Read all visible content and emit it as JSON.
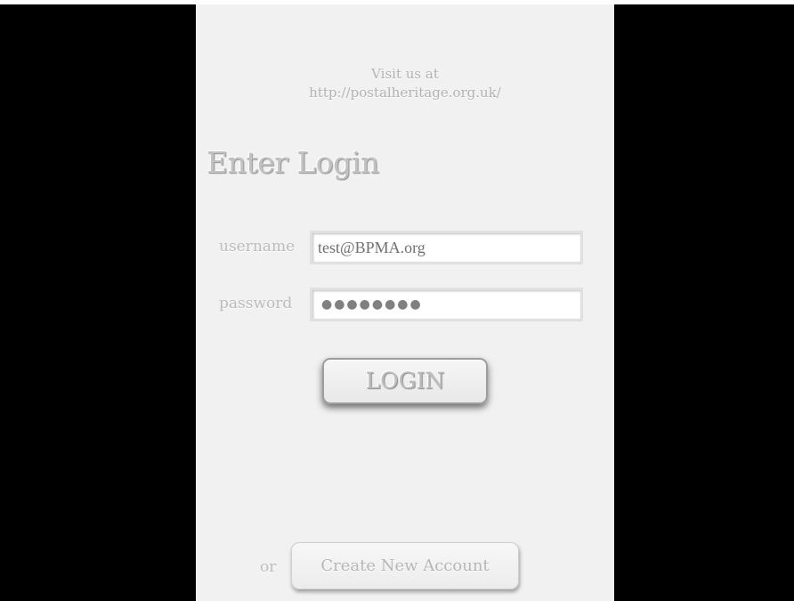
{
  "visit": {
    "line1": "Visit us at",
    "line2": "http://postalheritage.org.uk/"
  },
  "title": "Enter Login",
  "form": {
    "username_label": "username",
    "username_value": "test@BPMA.org",
    "password_label": "password",
    "password_mask": "●●●●●●●●"
  },
  "login_button": "LOGIN",
  "footer": {
    "or_text": "or",
    "create_account_label": "Create New Account"
  },
  "colors": {
    "background": "#000000",
    "panel": "#f1f1f1",
    "text_embossed": "#bcbcbc"
  }
}
